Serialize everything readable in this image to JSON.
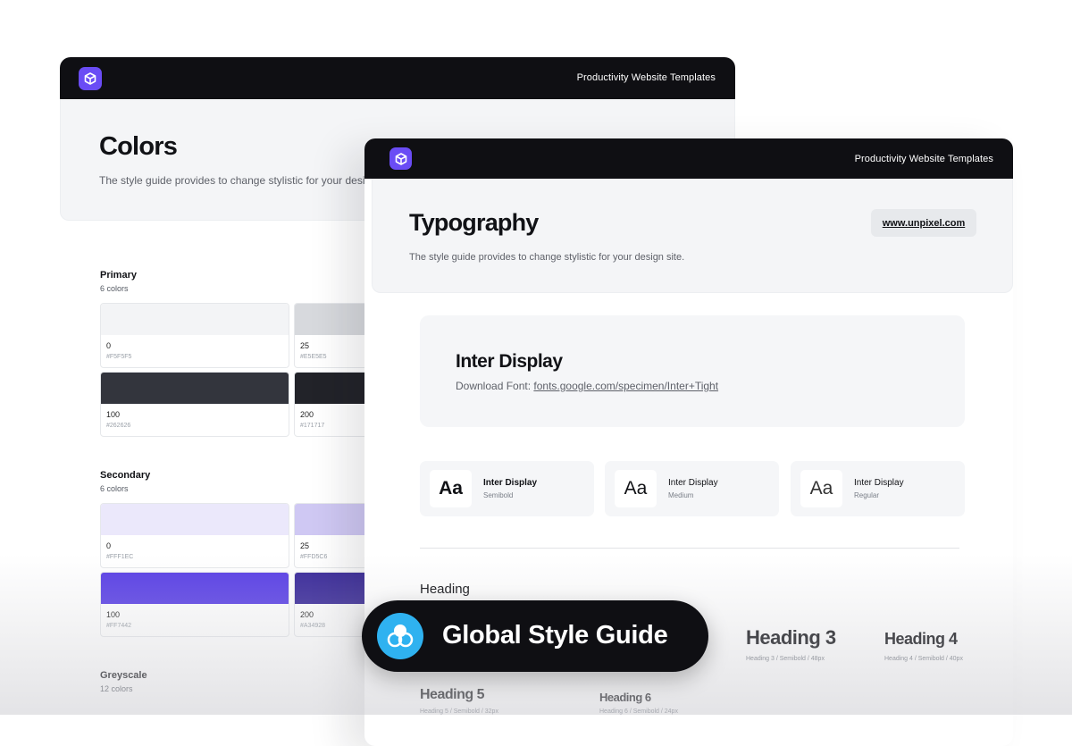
{
  "back_card": {
    "topbar_title": "Productivity Website Templates",
    "hero_title": "Colors",
    "hero_subtitle": "The style guide provides to change stylistic for your desig",
    "groups": [
      {
        "title": "Primary",
        "count": "6 colors",
        "swatches": [
          {
            "level": "0",
            "hex": "#F5F5F5",
            "color": "#f3f4f6"
          },
          {
            "level": "25",
            "hex": "#E5E5E5",
            "color": "#d7d9dd"
          },
          {
            "level": "100",
            "hex": "#262626",
            "color": "#33353d"
          },
          {
            "level": "200",
            "hex": "#171717",
            "color": "#222329"
          }
        ]
      },
      {
        "title": "Secondary",
        "count": "6 colors",
        "swatches": [
          {
            "level": "0",
            "hex": "#FFF1EC",
            "color": "#ebe8fb"
          },
          {
            "level": "25",
            "hex": "#FFD5C6",
            "color": "#cfc8f3"
          },
          {
            "level": "100",
            "hex": "#FF7442",
            "color": "#5a40e6"
          },
          {
            "level": "200",
            "hex": "#A34928",
            "color": "#3a2a9a"
          }
        ]
      },
      {
        "title": "Greyscale",
        "count": "12 colors",
        "swatches": []
      }
    ]
  },
  "front_card": {
    "topbar_title": "Productivity Website Templates",
    "hero_title": "Typography",
    "hero_subtitle": "The style guide provides to change stylistic for your design site.",
    "site_link": "www.unpixel.com",
    "font": {
      "name": "Inter Display",
      "download_label": "Download Font: ",
      "download_url": "fonts.google.com/specimen/Inter+Tight"
    },
    "weights": [
      {
        "sample": "Aa",
        "name": "Inter Display",
        "style": "Semibold"
      },
      {
        "sample": "Aa",
        "name": "Inter Display",
        "style": "Medium"
      },
      {
        "sample": "Aa",
        "name": "Inter Display",
        "style": "Regular"
      }
    ],
    "heading_section_label": "Heading",
    "headings": [
      {
        "label": "Heading 3",
        "spec": "Heading 3 / Semibold / 48px"
      },
      {
        "label": "Heading 4",
        "spec": "Heading 4 / Semibold / 40px"
      },
      {
        "label": "Heading 5",
        "spec": "Heading 5 / Semibold / 32px"
      },
      {
        "label": "Heading 6",
        "spec": "Heading 6 / Semibold / 24px"
      }
    ]
  },
  "badge": {
    "label": "Global Style Guide",
    "icon": "overlapping-circles-icon",
    "color": "#2fb2f0"
  },
  "colors": {
    "topbar": "#0f0f13",
    "logo": "#6a4cf5"
  },
  "icons": {
    "logo": "cube-icon"
  }
}
